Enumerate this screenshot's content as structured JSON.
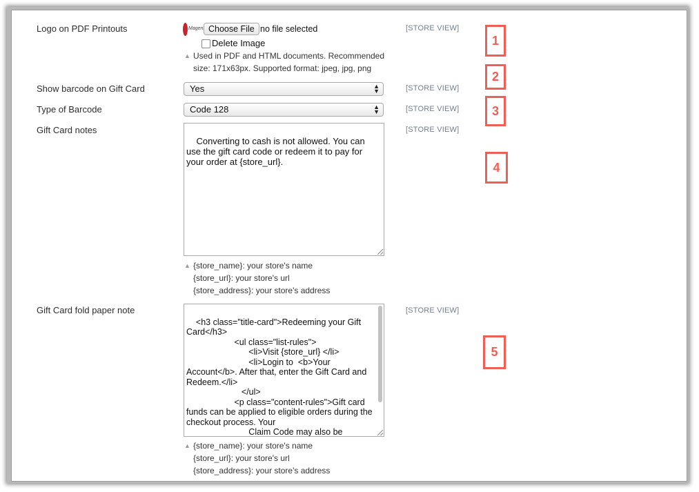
{
  "rows": {
    "logo": {
      "label": "Logo on PDF Printouts",
      "logo_text": "Magento",
      "choose_file": "Choose File",
      "file_status": "no file selected",
      "delete_label": "Delete Image",
      "note_line1": "Used in PDF and HTML documents. Recommended",
      "note_line2": "size: 171x63px. Supported format: jpeg, jpg, png",
      "scope": "[STORE VIEW]"
    },
    "barcode": {
      "label": "Show barcode on Gift Card",
      "value": "Yes",
      "scope": "[STORE VIEW]"
    },
    "barcode_type": {
      "label": "Type of Barcode",
      "value": "Code 128",
      "scope": "[STORE VIEW]"
    },
    "notes": {
      "label": "Gift Card notes",
      "value": "Converting to cash is not allowed. You can use the gift card code or redeem it to pay for your order at {store_url}.",
      "hint1": "{store_name}: your store's name",
      "hint2": "{store_url}: your store's url",
      "hint3": "{store_address}: your store's address",
      "scope": "[STORE VIEW]"
    },
    "fold": {
      "label": "Gift Card fold paper note",
      "value": "<h3 class=\"title-card\">Redeeming your Gift Card</h3>\n                    <ul class=\"list-rules\">\n                          <li>Visit {store_url} </li>\n                          <li>Login to  <b>Your Account</b>. After that, enter the Gift Card and Redeem.</li>\n                       </ul>\n                    <p class=\"content-rules\">Gift card funds can be applied to eligible orders during the checkout process. Your\n                          Claim Code may also be entered during checkout. To redeem your gift card, firstly",
      "hint1": "{store_name}: your store's name",
      "hint2": "{store_url}: your store's url",
      "hint3": "{store_address}: your store's address",
      "scope": "[STORE VIEW]"
    }
  },
  "markers": [
    "1",
    "2",
    "3",
    "4",
    "5"
  ],
  "colors": {
    "marker": "#f05f55",
    "scope": "#6f7f8f"
  }
}
